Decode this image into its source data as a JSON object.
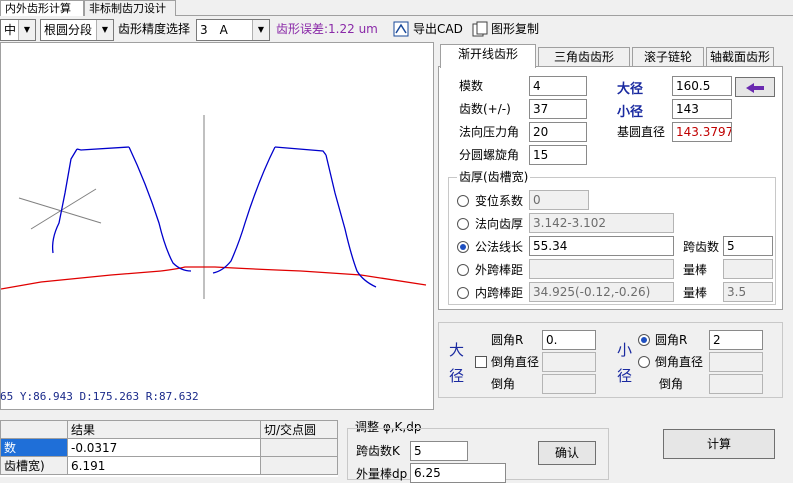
{
  "top_tabs": [
    "内外齿形计算",
    "非标制齿刀设计"
  ],
  "toolbar": {
    "combo1": "中",
    "combo2": "根圆分段",
    "precision_label": "齿形精度选择",
    "precision_value": "3　A",
    "error_text": "齿形误差:1.22 um",
    "export_cad": "导出CAD",
    "copy_figure": "图形复制"
  },
  "canvas": {
    "coord_readout": "65  Y:86.943  D:175.263  R:87.632"
  },
  "tabs": [
    "渐开线齿形",
    "三角齿齿形",
    "滚子链轮",
    "轴截面齿形"
  ],
  "params": {
    "module_label": "模数",
    "module_value": "4",
    "teeth_label": "齿数(+/-)",
    "teeth_value": "37",
    "pressure_label": "法向压力角",
    "pressure_value": "20",
    "helix_label": "分圆螺旋角",
    "helix_value": "15",
    "major_label": "大径",
    "major_value": "160.5",
    "minor_label": "小径",
    "minor_value": "143",
    "base_label": "基圆直径",
    "base_value": "143.3797"
  },
  "thickness": {
    "legend": "齿厚(齿槽宽)",
    "shift_label": "变位系数",
    "shift_value": "0",
    "normal_label": "法向齿厚",
    "normal_value": "3.142-3.102",
    "wk_label": "公法线长",
    "wk_value": "55.34",
    "span_label": "跨齿数",
    "span_value": "5",
    "outer_pin_label": "外跨棒距",
    "outer_pin_value": "",
    "pin_label_1": "量棒",
    "pin_value_1": "",
    "inner_pin_label": "内跨棒距",
    "inner_pin_value": "34.925(-0.12,-0.26)",
    "pin_label_2": "量棒",
    "pin_value_2": "3.5"
  },
  "fillet": {
    "big_label_1": "大",
    "big_label_2": "径",
    "small_label_1": "小",
    "small_label_2": "径",
    "big_radius_label": "圆角R",
    "big_radius_value": "0.",
    "big_chamfer_dia_label": "倒角直径",
    "big_chamfer_label": "倒角",
    "small_radius_label": "圆角R",
    "small_radius_value": "2",
    "small_chamfer_dia_label": "倒角直径",
    "small_chamfer_label": "倒角"
  },
  "results": {
    "headers": [
      "",
      "结果",
      "切/交点圆"
    ],
    "rows": [
      {
        "name": "数",
        "value": "-0.0317",
        "extra": ""
      },
      {
        "name": "齿槽宽)",
        "value": "6.191",
        "extra": ""
      }
    ]
  },
  "adjust": {
    "title": "调整 φ,K,dp",
    "span_label": "跨齿数K",
    "span_value": "5",
    "pin_label": "外量棒dp",
    "pin_value": "6.25",
    "confirm": "确认"
  },
  "calculate": "计算",
  "colors": {
    "profile": "#0000cc",
    "root": "#e00000",
    "axis": "#808080"
  }
}
